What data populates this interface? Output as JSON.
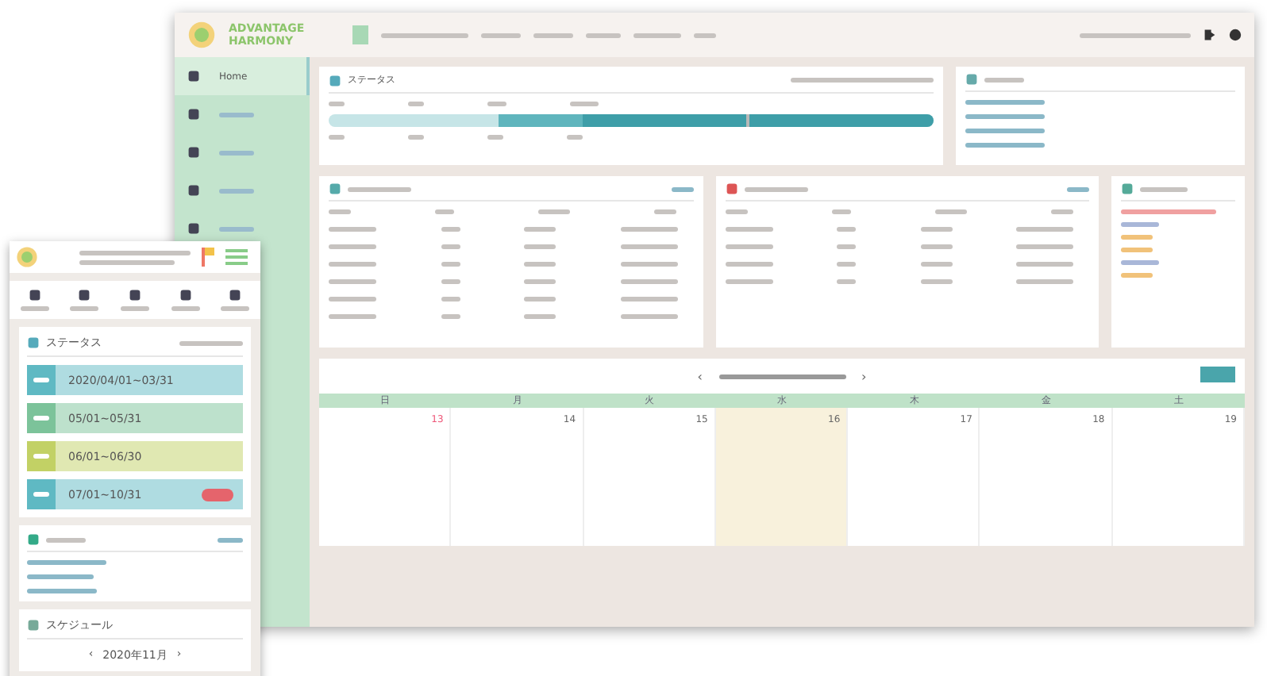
{
  "desktop": {
    "logo": {
      "line1": "ADVANTAGE",
      "line2": "HARMONY"
    },
    "sidebar": {
      "items": [
        {
          "label": "Home",
          "selected": true
        },
        {
          "selected": false
        },
        {
          "selected": false
        },
        {
          "selected": false
        },
        {
          "selected": false
        }
      ]
    },
    "status": {
      "title": "ステータス",
      "level": 0.69
    },
    "calendar": {
      "prev": "‹",
      "next": "›",
      "weekdays": [
        "日",
        "月",
        "火",
        "水",
        "木",
        "金",
        "土"
      ],
      "days": [
        {
          "day": "13",
          "holiday": true,
          "selected": false
        },
        {
          "day": "14",
          "holiday": false,
          "selected": false
        },
        {
          "day": "15",
          "holiday": false,
          "selected": false
        },
        {
          "day": "16",
          "holiday": false,
          "selected": true
        },
        {
          "day": "17",
          "holiday": false,
          "selected": false
        },
        {
          "day": "18",
          "holiday": false,
          "selected": false
        },
        {
          "day": "19",
          "holiday": false,
          "selected": false
        }
      ]
    }
  },
  "mobile": {
    "status_title": "ステータス",
    "phases": [
      {
        "dates": "2020/04/01~03/31",
        "color": "#5fb9c3",
        "flagged": false
      },
      {
        "dates": "05/01~05/31",
        "color": "#7cc39a",
        "flagged": false
      },
      {
        "dates": "06/01~06/30",
        "color": "#c2d165",
        "flagged": false
      },
      {
        "dates": "07/01~10/31",
        "color": "#5fb9c3",
        "flagged": true
      }
    ],
    "schedule_title": "スケジュール",
    "month": "2020年11月",
    "prev": "‹",
    "next": "›"
  }
}
